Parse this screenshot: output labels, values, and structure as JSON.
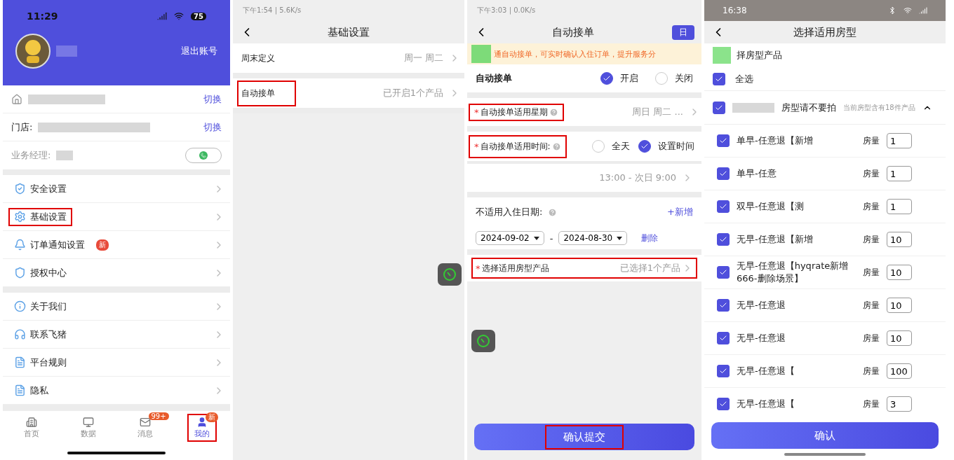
{
  "profile_screen": {
    "status_time": "11:29",
    "battery": "75",
    "logout": "退出账号",
    "hotel_row": {
      "action": "切换"
    },
    "store_row": {
      "label": "门店:",
      "action": "切换"
    },
    "manager_label": "业务经理:",
    "menu_groups": [
      [
        {
          "label": "安全设置",
          "highlighted": false
        },
        {
          "label": "基础设置",
          "highlighted": true
        },
        {
          "label": "订单通知设置",
          "badge": "新",
          "highlighted": false
        },
        {
          "label": "授权中心",
          "highlighted": false
        }
      ],
      [
        {
          "label": "关于我们",
          "highlighted": false
        },
        {
          "label": "联系飞猪",
          "highlighted": false
        },
        {
          "label": "平台规则",
          "highlighted": false
        },
        {
          "label": "隐私",
          "highlighted": false
        }
      ]
    ],
    "tabs": [
      {
        "label": "首页",
        "selected": false,
        "highlighted": false
      },
      {
        "label": "数据",
        "selected": false,
        "highlighted": false
      },
      {
        "label": "消息",
        "badge": "99+",
        "selected": false,
        "highlighted": false
      },
      {
        "label": "我的",
        "badge": "新",
        "selected": true,
        "highlighted": true
      }
    ]
  },
  "basic_settings_screen": {
    "status": "下午1:54 | 5.6K/s",
    "title": "基础设置",
    "rows": [
      {
        "label": "周末定义",
        "value": "周一 周二",
        "highlighted": false
      },
      {
        "label": "自动接单",
        "value": "已开启1个产品",
        "highlighted": true
      }
    ]
  },
  "auto_accept_screen": {
    "status": "下午3:03 | 0.0K/s",
    "title": "自动接单",
    "log_button": "日",
    "notice": "通自动接单，可实时确认入住订单，提升服务分",
    "toggle": {
      "label": "自动接单",
      "options": [
        {
          "label": "开启",
          "selected": true
        },
        {
          "label": "关闭",
          "selected": false
        }
      ]
    },
    "weekday_row": {
      "required_mark": "*",
      "label": "自动接单适用星期",
      "value": "周日 周二 ...",
      "highlighted": true
    },
    "time_row": {
      "required_mark": "*",
      "label": "自动接单适用时间:",
      "highlighted": true,
      "options": [
        {
          "label": "全天",
          "selected": false
        },
        {
          "label": "设置时间",
          "selected": true
        }
      ]
    },
    "time_value": "13:00 - 次日 9:00",
    "excluded": {
      "label": "不适用入住日期:",
      "add": "+新增",
      "start": "2024-09-02",
      "separator": "-",
      "end": "2024-08-30",
      "delete": "删除"
    },
    "product_row": {
      "required_mark": "*",
      "label": "选择适用房型产品",
      "value": "已选择1个产品",
      "highlighted": true
    },
    "submit": {
      "label": "确认提交",
      "highlighted": true
    }
  },
  "room_type_screen": {
    "status_time": "16:38",
    "title": "选择适用房型",
    "section_label": "择房型产品",
    "select_all": {
      "label": "全选",
      "checked": true
    },
    "group": {
      "name": "房型请不要拍",
      "note": "当前房型含有18件产品",
      "checked": true,
      "expanded": true
    },
    "items": [
      {
        "name": "单早-任意退【新增",
        "qty_label": "房量",
        "qty": "1",
        "checked": true
      },
      {
        "name": "单早-任意",
        "qty_label": "房量",
        "qty": "1",
        "checked": true
      },
      {
        "name": "双早-任意退【测",
        "qty_label": "房量",
        "qty": "1",
        "checked": true
      },
      {
        "name": "无早-任意退【新增",
        "qty_label": "房量",
        "qty": "10",
        "checked": true
      },
      {
        "name": "无早-任意退【hyqrate新增666-删除场景】",
        "qty_label": "房量",
        "qty": "10",
        "checked": true
      },
      {
        "name": "无早-任意退",
        "qty_label": "房量",
        "qty": "10",
        "checked": true
      },
      {
        "name": "无早-任意退",
        "qty_label": "房量",
        "qty": "10",
        "checked": true
      },
      {
        "name": "无早-任意退【",
        "qty_label": "房量",
        "qty": "100",
        "checked": true
      },
      {
        "name": "无早-任意退【",
        "qty_label": "房量",
        "qty": "3",
        "checked": true
      }
    ],
    "confirm": "确认"
  }
}
